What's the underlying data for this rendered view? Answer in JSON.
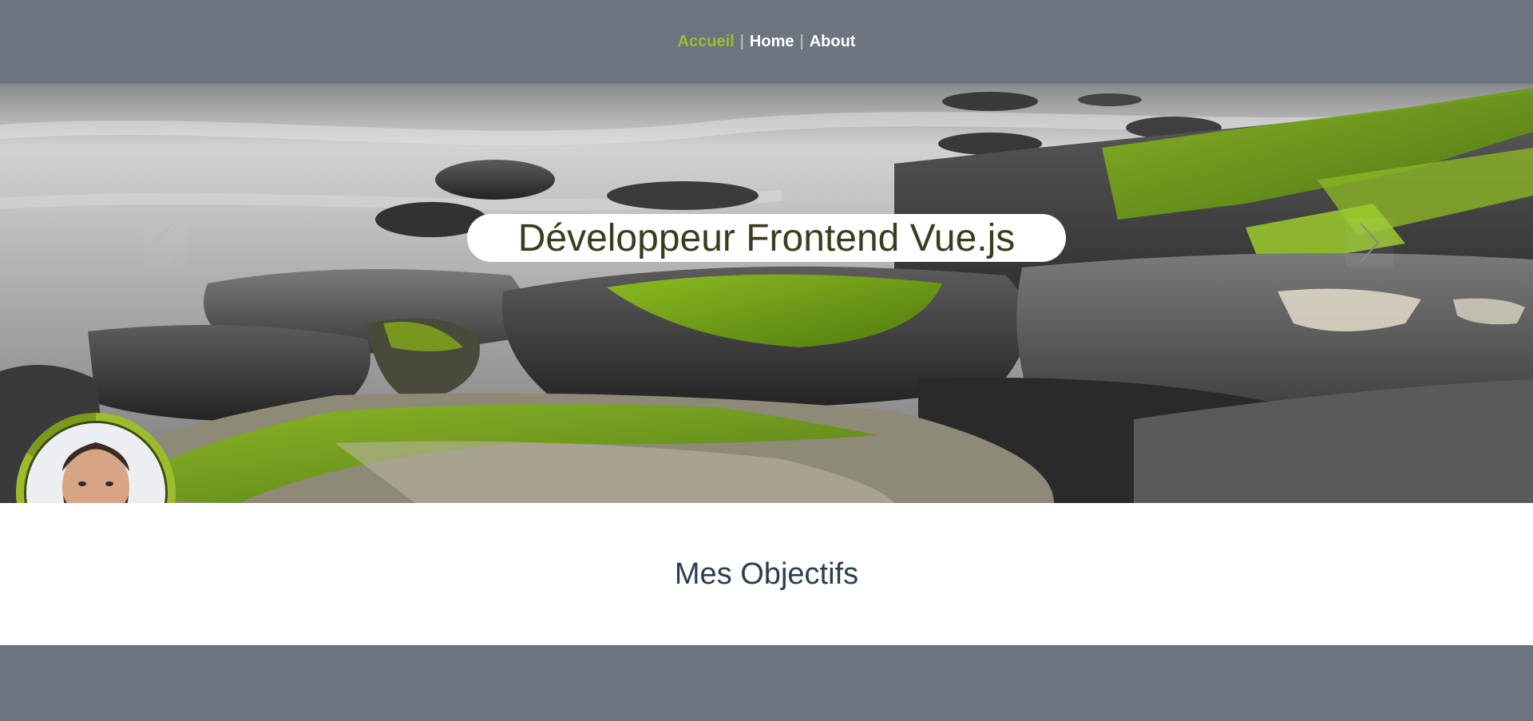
{
  "nav": {
    "links": [
      {
        "label": "Accueil"
      },
      {
        "label": "Home"
      },
      {
        "label": "About"
      }
    ],
    "separator": "|"
  },
  "hero": {
    "title": "Développeur Frontend Vue.js",
    "prev_icon": "chevron-left-icon",
    "next_icon": "chevron-right-icon"
  },
  "section": {
    "heading": "Mes Objectifs"
  },
  "colors": {
    "accent": "#9bbd2b",
    "nav_bg": "#6c757f",
    "heading": "#2c3e50",
    "hero_title": "#3b3b1e"
  }
}
